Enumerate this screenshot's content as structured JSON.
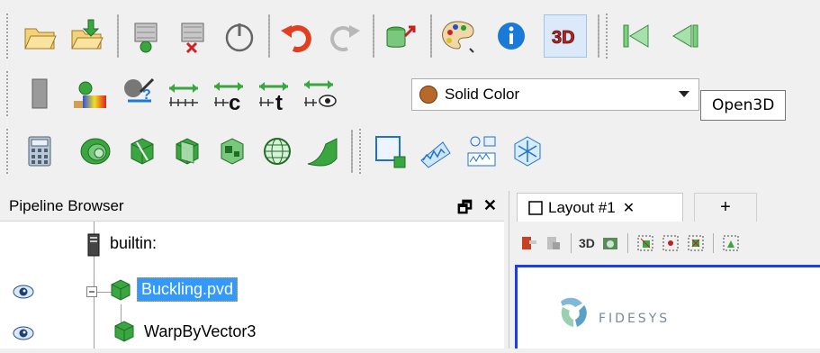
{
  "toolbar_row2": {
    "color_combo": {
      "value": "Solid Color",
      "swatch_color": "#b8692a"
    }
  },
  "tooltip": {
    "text": "Open3D"
  },
  "pipeline": {
    "title": "Pipeline Browser",
    "float_glyph": "🗗",
    "close_glyph": "✕",
    "items": [
      {
        "label": "builtin:",
        "icon": "server-icon",
        "visible": null
      },
      {
        "label": "Buckling.pvd",
        "icon": "cube-source-icon",
        "visible": true,
        "selected": true
      },
      {
        "label": "WarpByVector3",
        "icon": "cube-filter-icon",
        "visible": true
      }
    ]
  },
  "layout": {
    "tabs": [
      {
        "label": "Layout #1",
        "close": "✕"
      },
      {
        "label": "+"
      }
    ],
    "view_mode": "3D",
    "logo_text": "FIDESYS"
  },
  "colors": {
    "accent_blue": "#1f3fe0",
    "selection": "#3399ff",
    "toolbar_bg": "#f0f0f0"
  }
}
